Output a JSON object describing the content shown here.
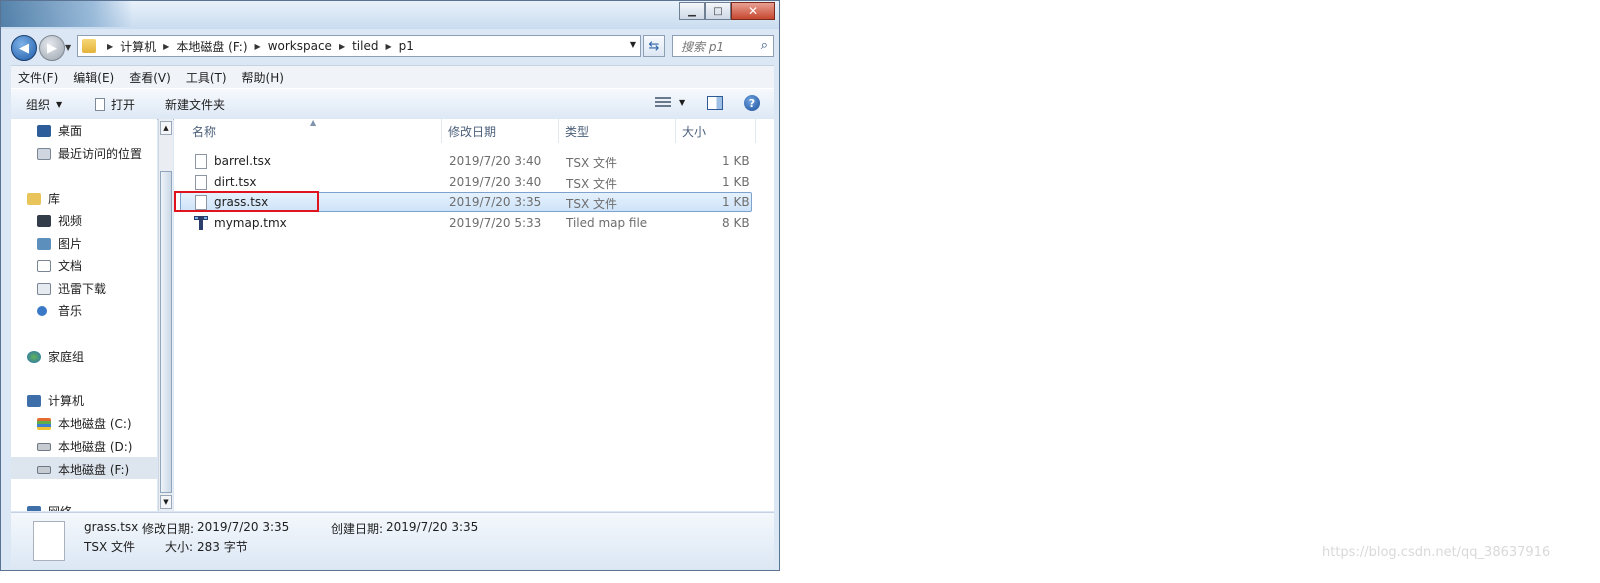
{
  "address": {
    "crumbs": [
      "计算机",
      "本地磁盘 (F:)",
      "workspace",
      "tiled",
      "p1"
    ]
  },
  "search": {
    "placeholder": "搜索 p1"
  },
  "menu": [
    "文件(F)",
    "编辑(E)",
    "查看(V)",
    "工具(T)",
    "帮助(H)"
  ],
  "toolbar": {
    "organize": "组织",
    "open": "打开",
    "new_folder": "新建文件夹"
  },
  "nav": {
    "desktop": "桌面",
    "recent": "最近访问的位置",
    "libraries": "库",
    "videos": "视频",
    "pictures": "图片",
    "documents": "文档",
    "xunlei": "迅雷下载",
    "music": "音乐",
    "homegroup": "家庭组",
    "computer": "计算机",
    "drive_c": "本地磁盘 (C:)",
    "drive_d": "本地磁盘 (D:)",
    "drive_f": "本地磁盘 (F:)",
    "network": "网络"
  },
  "columns": {
    "name": "名称",
    "date": "修改日期",
    "type": "类型",
    "size": "大小"
  },
  "files": [
    {
      "name": "barrel.tsx",
      "date": "2019/7/20 3:40",
      "type": "TSX 文件",
      "size": "1 KB"
    },
    {
      "name": "dirt.tsx",
      "date": "2019/7/20 3:40",
      "type": "TSX 文件",
      "size": "1 KB"
    },
    {
      "name": "grass.tsx",
      "date": "2019/7/20 3:35",
      "type": "TSX 文件",
      "size": "1 KB"
    },
    {
      "name": "mymap.tmx",
      "date": "2019/7/20 5:33",
      "type": "Tiled map file",
      "size": "8 KB"
    }
  ],
  "details": {
    "filename": "grass.tsx",
    "modified_label": "修改日期:",
    "modified_value": "2019/7/20 3:35",
    "created_label": "创建日期:",
    "created_value": "2019/7/20 3:35",
    "type": "TSX 文件",
    "size_label": "大小:",
    "size_value": "283 字节"
  },
  "watermark": "https://blog.csdn.net/qq_38637916"
}
